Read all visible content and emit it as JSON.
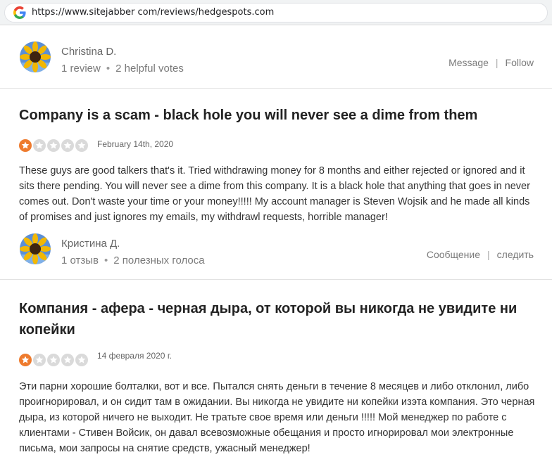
{
  "browser": {
    "url": "https://www.sitejabber com/reviews/hedgespots.com"
  },
  "reviews": [
    {
      "reviewer": {
        "name": "Christina D.",
        "reviews_count": "1 review",
        "helpful_votes": "2 helpful votes",
        "message_label": "Message",
        "follow_label": "Follow"
      },
      "title": "Company is a scam - black hole you will never see a dime from them",
      "rating": 1,
      "date": "February 14th, 2020",
      "body": "These guys are good talkers that's it. Tried withdrawing money for 8 months and either rejected or ignored and it sits there pending. You will never see a dime from this company. It is a black hole that anything that goes in never comes out. Don't waste your time or your money!!!!! My account manager is Steven Wojsik and he made all kinds of promises and just ignores my emails, my withdrawl requests, horrible manager!"
    },
    {
      "reviewer": {
        "name": "Кристина Д.",
        "reviews_count": "1 отзыв",
        "helpful_votes": "2 полезных голоса",
        "message_label": "Сообщение",
        "follow_label": "следить"
      },
      "title": "Компания - афера - черная дыра, от которой вы никогда не увидите ни копейки",
      "rating": 1,
      "date": "14 февраля 2020 г.",
      "body": "Эти парни хорошие болталки, вот и все. Пытался снять деньги в течение 8 месяцев и либо отклонил, либо проигнорировал, и он сидит там в ожидании. Вы никогда не увидите ни копейки изэта компания. Это черная дыра, из которой ничего не выходит. Не тратьте свое время или деньги !!!!! Мой менеджер по работе с клиентами - Стивен Войсик, он давал всевозможные обещания и просто игнорировал мои электронные письма, мои запросы на снятие средств, ужасный менеджер!"
    }
  ],
  "colors": {
    "star_active": "#ee7b2e",
    "star_inactive": "#dadada"
  },
  "icons": {
    "browser": "google-g-icon",
    "avatar": "sunflower-avatar-icon",
    "star": "star-icon"
  }
}
